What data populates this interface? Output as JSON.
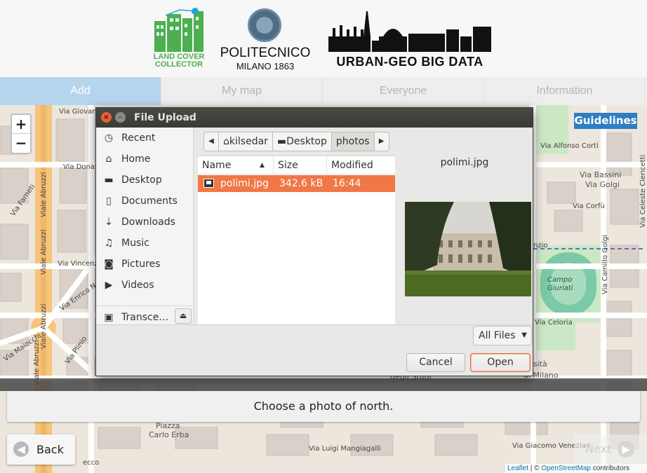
{
  "header": {
    "logo_lcc": {
      "line1": "LAND COVER",
      "line2": "COLLECTOR"
    },
    "logo_polimi": {
      "name": "POLITECNICO",
      "sub": "MILANO 1863"
    },
    "logo_urban": {
      "text": "URBAN-GEO BIG DATA"
    }
  },
  "tabs": [
    {
      "label": "Add",
      "active": true
    },
    {
      "label": "My map",
      "active": false
    },
    {
      "label": "Everyone",
      "active": false
    },
    {
      "label": "Information",
      "active": false
    }
  ],
  "map": {
    "zoom_in": "+",
    "zoom_out": "−",
    "guidelines_label": "Guidelines",
    "streets": {
      "via_giovanni_pi": "Via Giovanni Pi",
      "via_donatello": "Via Donate",
      "via_farneti": "Via Farneti",
      "viale_abruzzi_1": "Viale Abruzzi",
      "viale_abruzzi_2": "Viale Abruzzi",
      "viale_abruzzi_3": "Viale Abruzzi",
      "viale_abruzzi_4": "Viale Abruzzi",
      "via_vincenzo": "Via Vincenzo",
      "via_enrico_no": "Via Enrico No",
      "via_maiocchi": "Via Maiocchi",
      "via_plinio": "Via Plinio",
      "via_alfonso_corti": "Via Alfonso Corti",
      "via_bassini": "Via Bassini",
      "via_golgi": "Via Golgi",
      "via_celeste_clericetti": "Via Celeste Clericetti",
      "via_corfu": "Via Corfù",
      "via_camillo_golgi": "Via Camillo Golgi",
      "via_celoria": "Via Celoria",
      "nzio": "nzio",
      "via_luigi_mangiagalli": "Via Luigi Mangiagalli",
      "via_giacomo_venezian": "Via Giacomo Venezian",
      "degli_studi": "degli Studi",
      "di_milano": "di Milano",
      "sita": "sità",
      "piazza": "Piazza",
      "carlo_erba": "Carlo Erba",
      "campo": "Campo",
      "giuriati": "Giuriati",
      "ecco": "ecco"
    },
    "attribution": {
      "leaflet": "Leaflet",
      "sep": " | © ",
      "osm": "OpenStreetMap",
      "tail": " contributors"
    },
    "colors": {
      "park": "#cbe8c4",
      "track": "#7cc9a7",
      "pitch": "#a9dcbf",
      "road_major": "#f6c47a",
      "building": "#d9d0c9"
    }
  },
  "instruction": "Choose a photo of north.",
  "nav": {
    "back_label": "Back",
    "next_label": "Next",
    "back_icon": "arrow-left-icon",
    "next_icon": "arrow-right-icon"
  },
  "dialog": {
    "title": "File Upload",
    "sidebar": [
      {
        "label": "Recent",
        "icon": "clock-icon"
      },
      {
        "label": "Home",
        "icon": "home-icon"
      },
      {
        "label": "Desktop",
        "icon": "folder-icon"
      },
      {
        "label": "Documents",
        "icon": "document-icon"
      },
      {
        "label": "Downloads",
        "icon": "download-icon"
      },
      {
        "label": "Music",
        "icon": "music-icon"
      },
      {
        "label": "Pictures",
        "icon": "camera-icon"
      },
      {
        "label": "Videos",
        "icon": "video-icon"
      },
      {
        "label": "Transce…",
        "icon": "drive-icon"
      }
    ],
    "path": [
      "kilsedar",
      "Desktop",
      "photos"
    ],
    "columns": {
      "name": "Name",
      "size": "Size",
      "modified": "Modified"
    },
    "files": [
      {
        "name": "polimi.jpg",
        "size": "342.6 kB",
        "modified": "16:44",
        "selected": true
      }
    ],
    "preview_name": "polimi.jpg",
    "filter": "All Files",
    "cancel_label": "Cancel",
    "open_label": "Open"
  }
}
